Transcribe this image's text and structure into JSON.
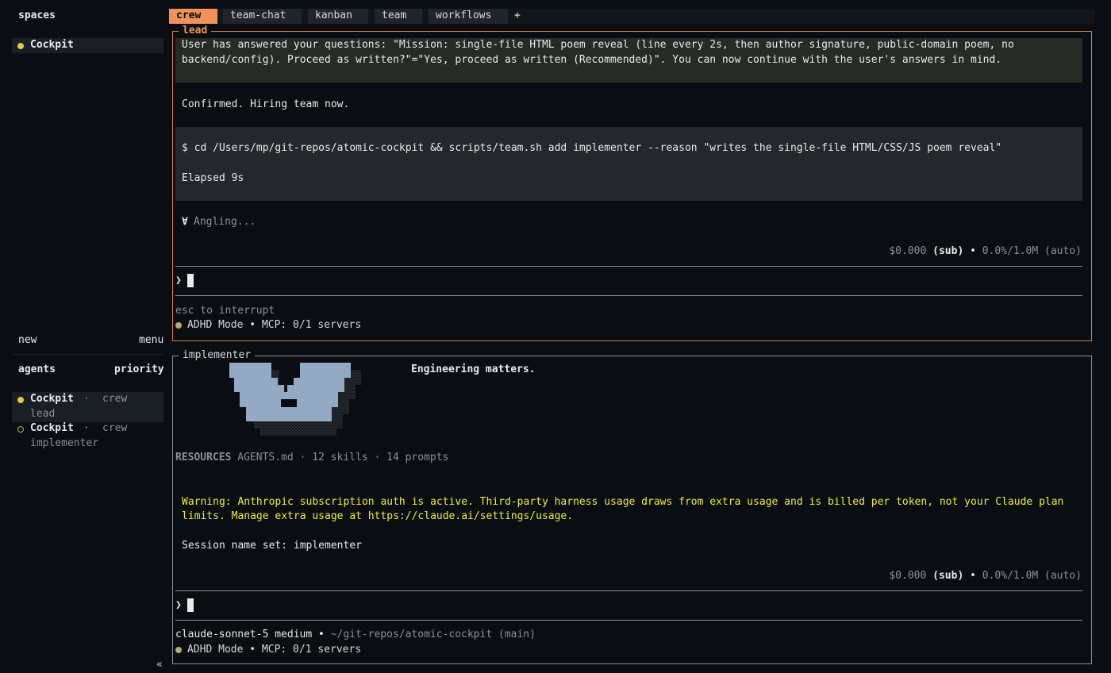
{
  "sidebar": {
    "spaces_title": "spaces",
    "spaces": [
      {
        "name": "Cockpit",
        "status_color": "#e2c94a"
      }
    ],
    "new_label": "new",
    "menu_label": "menu",
    "agents_title": "agents",
    "priority_label": "priority",
    "agents": [
      {
        "name": "Cockpit",
        "sep": "·",
        "group": "crew",
        "role": "lead",
        "state": "active"
      },
      {
        "name": "Cockpit",
        "sep": "·",
        "group": "crew",
        "role": "implementer",
        "state": "idle"
      }
    ],
    "collapse_glyph": "«"
  },
  "tabs": [
    {
      "label": "crew",
      "active": true
    },
    {
      "label": "team-chat",
      "active": false
    },
    {
      "label": "kanban",
      "active": false
    },
    {
      "label": "team",
      "active": false
    },
    {
      "label": "workflows",
      "active": false
    }
  ],
  "add_tab": "+",
  "lead": {
    "title": "lead",
    "answer_line1": "User has answered your questions: \"Mission: single-file HTML poem reveal (line every 2s, then author signature, public-domain poem, no",
    "answer_line2": "backend/config). Proceed as written?\"=\"Yes, proceed as written (Recommended)\". You can now continue with the user's answers in mind.",
    "confirm": "Confirmed. Hiring team now.",
    "command": "$ cd /Users/mp/git-repos/atomic-cockpit && scripts/team.sh add implementer --reason \"writes the single-file HTML/CSS/JS poem reveal\"",
    "elapsed": "Elapsed 9s",
    "spinner_glyph": "∀",
    "spinner_text": "Angling...",
    "cost": "$0.000",
    "sub": "(sub)",
    "bullet": "•",
    "usage": "0.0%/1.0M (auto)",
    "prompt_glyph": "❯",
    "hint": "esc to interrupt",
    "status": "ADHD Mode • MCP: 0/1 servers"
  },
  "implementer": {
    "title": "implementer",
    "tagline": "Engineering matters.",
    "resources_label": "RESOURCES",
    "resources_value": "AGENTS.md · 12 skills · 14 prompts",
    "warning_line1": "Warning: Anthropic subscription auth is active. Third-party harness usage draws from extra usage and is billed per token, not your Claude plan",
    "warning_line2": "limits. Manage extra usage at https://claude.ai/settings/usage.",
    "session": "Session name set: implementer",
    "cost": "$0.000",
    "sub": "(sub)",
    "bullet": "•",
    "usage": "0.0%/1.0M (auto)",
    "prompt_glyph": "❯",
    "model": "claude-sonnet-5 medium",
    "model_bullet": "•",
    "cwd": "~/git-repos/atomic-cockpit (main)",
    "status": "ADHD Mode • MCP: 0/1 servers"
  },
  "colors": {
    "accent": "#f0935a",
    "lead_border": "#d9824f",
    "warning": "#ecec3a",
    "status_dot": "#b7ab6c",
    "logo_fill": "#94a9c4"
  }
}
